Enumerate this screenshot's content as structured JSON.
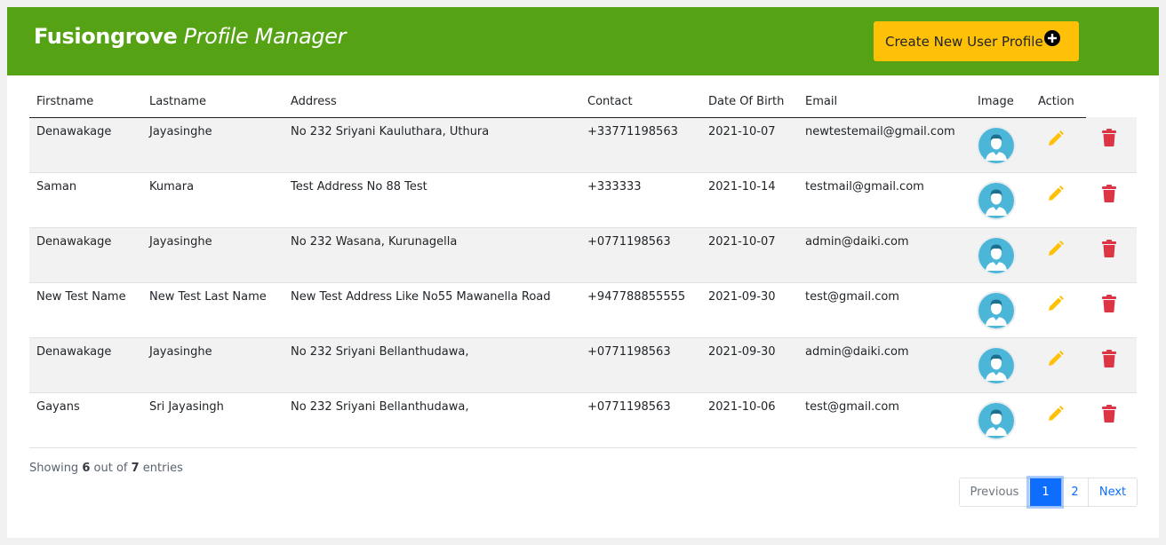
{
  "header": {
    "brand_bold": "Fusiongrove",
    "brand_italic": "Profile Manager",
    "create_label": "Create New User Profile",
    "color": "#55a214"
  },
  "table": {
    "columns": [
      "Firstname",
      "Lastname",
      "Address",
      "Contact",
      "Date Of Birth",
      "Email",
      "Image",
      "Action"
    ],
    "rows": [
      {
        "firstname": "Denawakage",
        "lastname": "Jayasinghe",
        "address": "No 232 Sriyani Kauluthara, Uthura",
        "contact": "+33771198563",
        "dob": "2021-10-07",
        "email": "newtestemail@gmail.com"
      },
      {
        "firstname": "Saman",
        "lastname": "Kumara",
        "address": "Test Address No 88 Test",
        "contact": "+333333",
        "dob": "2021-10-14",
        "email": "testmail@gmail.com"
      },
      {
        "firstname": "Denawakage",
        "lastname": "Jayasinghe",
        "address": "No 232 Wasana, Kurunagella",
        "contact": "+0771198563",
        "dob": "2021-10-07",
        "email": "admin@daiki.com"
      },
      {
        "firstname": "New Test Name",
        "lastname": "New Test Last Name",
        "address": "New Test Address Like No55 Mawanella Road",
        "contact": "+947788855555",
        "dob": "2021-09-30",
        "email": "test@gmail.com"
      },
      {
        "firstname": "Denawakage",
        "lastname": "Jayasinghe",
        "address": "No 232 Sriyani Bellanthudawa,",
        "contact": "+0771198563",
        "dob": "2021-09-30",
        "email": "admin@daiki.com"
      },
      {
        "firstname": "Gayans",
        "lastname": "Sri Jayasingh",
        "address": "No 232 Sriyani Bellanthudawa,",
        "contact": "+0771198563",
        "dob": "2021-10-06",
        "email": "test@gmail.com"
      }
    ],
    "icons": {
      "image": "user-avatar-icon",
      "edit": "pencil-icon",
      "delete": "trash-icon"
    },
    "colors": {
      "edit": "#ffc107",
      "delete": "#dc3545",
      "avatar": "#4bb6d8"
    }
  },
  "footer": {
    "showing_prefix": "Showing",
    "showing_count": "6",
    "showing_mid": "out of",
    "showing_total": "7",
    "showing_suffix": "entries"
  },
  "pagination": {
    "previous": "Previous",
    "pages": [
      "1",
      "2"
    ],
    "current": "1",
    "next": "Next"
  }
}
